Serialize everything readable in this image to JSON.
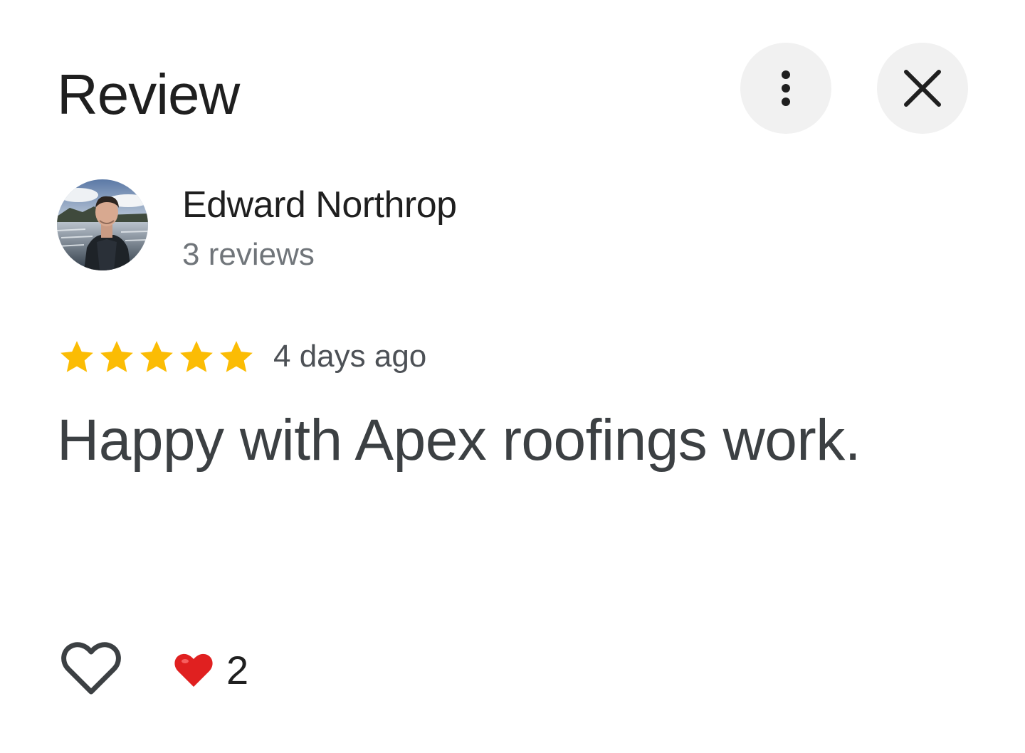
{
  "header": {
    "title": "Review",
    "more_icon": "more-vert-icon",
    "close_icon": "close-icon"
  },
  "author": {
    "name": "Edward Northrop",
    "review_count": "3 reviews"
  },
  "review": {
    "rating": 5,
    "rating_max": 5,
    "date": "4 days ago",
    "text": "Happy with Apex roofings work."
  },
  "reactions": {
    "like_icon": "heart-outline-icon",
    "reaction_icon": "red-heart-icon",
    "count": "2"
  },
  "colors": {
    "star": "#fbbc04",
    "button_bg": "#f1f1f1",
    "heart": "#e02020"
  }
}
